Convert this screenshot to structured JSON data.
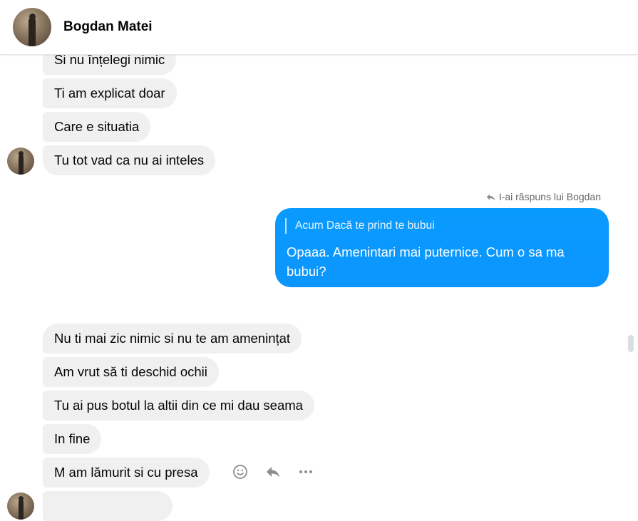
{
  "header": {
    "contact_name": "Bogdan Matei"
  },
  "messages_top": [
    {
      "text": "Si nu înțelegi nimic"
    },
    {
      "text": "Ti am explicat doar"
    },
    {
      "text": "Care e situatia"
    },
    {
      "text": "Tu tot vad ca nu ai inteles"
    }
  ],
  "reply": {
    "note": "I-ai răspuns lui Bogdan",
    "quoted": "Acum Dacă te prind te bubui",
    "text": "Opaaa. Amenintari mai puternice. Cum o sa ma bubui?"
  },
  "messages_bottom": [
    {
      "text": "Nu ti mai zic nimic si nu te am amenințat"
    },
    {
      "text": "Am vrut să ti deschid ochii"
    },
    {
      "text": "Tu ai pus botul la altii din ce mi dau seama"
    },
    {
      "text": "In fine"
    },
    {
      "text": "M am lămurit si cu presa"
    }
  ],
  "icons": {
    "react": "smiley-icon",
    "reply": "reply-arrow-icon",
    "more": "more-dots-icon"
  },
  "colors": {
    "outgoing_bubble": "#0a9bfe",
    "incoming_bubble": "#f0f0f0"
  }
}
